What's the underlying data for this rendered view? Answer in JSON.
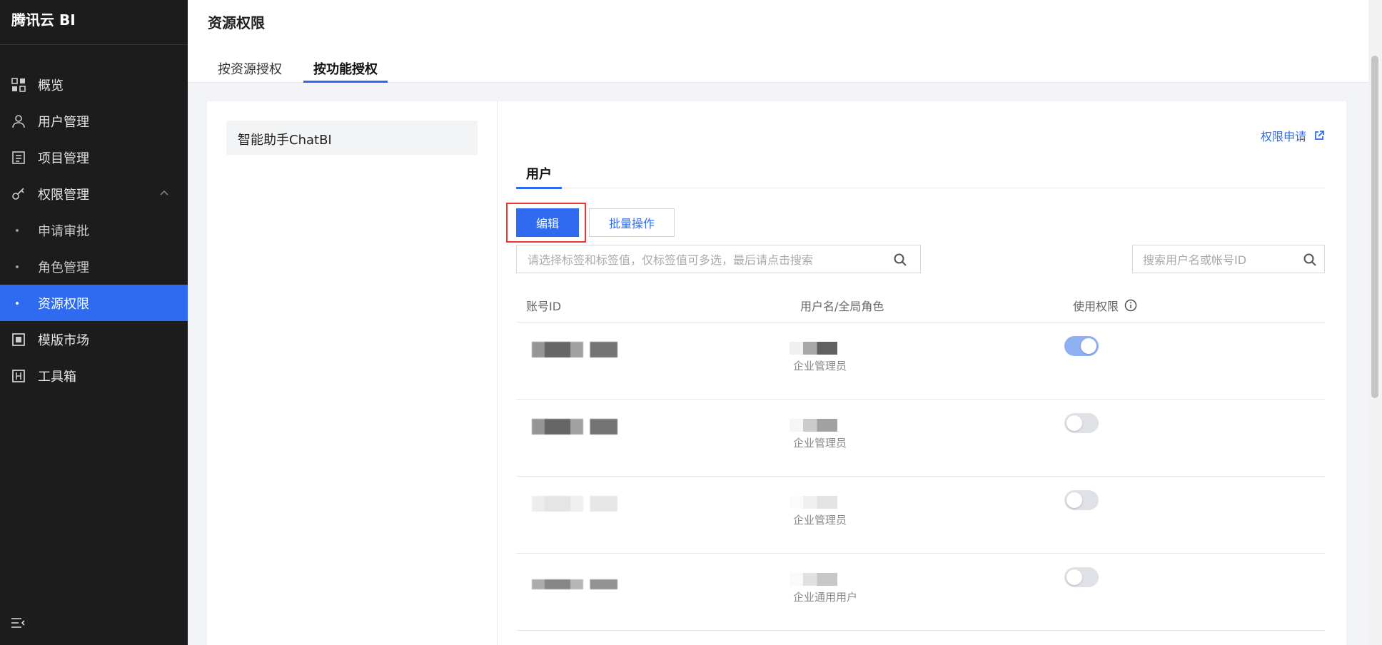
{
  "app": {
    "brand": "腾讯云 BI"
  },
  "sidebar": {
    "items": [
      {
        "label": "概览",
        "icon": "dashboard-icon"
      },
      {
        "label": "用户管理",
        "icon": "user-icon"
      },
      {
        "label": "项目管理",
        "icon": "project-icon"
      },
      {
        "label": "权限管理",
        "icon": "key-icon",
        "expanded": true
      },
      {
        "label": "申请审批",
        "sub": true
      },
      {
        "label": "角色管理",
        "sub": true
      },
      {
        "label": "资源权限",
        "sub": true,
        "active": true
      },
      {
        "label": "模版市场",
        "icon": "template-icon"
      },
      {
        "label": "工具箱",
        "icon": "toolbox-icon"
      }
    ]
  },
  "header": {
    "title": "资源权限",
    "tabs": [
      {
        "label": "按资源授权",
        "active": false
      },
      {
        "label": "按功能授权",
        "active": true
      }
    ]
  },
  "left_panel": {
    "items": [
      {
        "label": "智能助手ChatBI"
      }
    ]
  },
  "right": {
    "apply_link": "权限申请",
    "subtab": "用户",
    "edit_button": "编辑",
    "batch_button": "批量操作",
    "search_tags_placeholder": "请选择标签和标签值，仅标签值可多选，最后请点击搜索",
    "search_user_placeholder": "搜索用户名或帐号ID",
    "table": {
      "headers": {
        "account": "账号ID",
        "user": "用户名/全局角色",
        "permission": "使用权限"
      },
      "rows": [
        {
          "role": "企业管理员",
          "enabled": true
        },
        {
          "role": "企业管理员",
          "enabled": false
        },
        {
          "role": "企业管理员",
          "enabled": false
        },
        {
          "role": "企业通用用户",
          "enabled": false
        }
      ]
    }
  },
  "colors": {
    "accent": "#2e6bf0",
    "sidebar_bg": "#1c1c1c",
    "highlight": "#e33333"
  }
}
